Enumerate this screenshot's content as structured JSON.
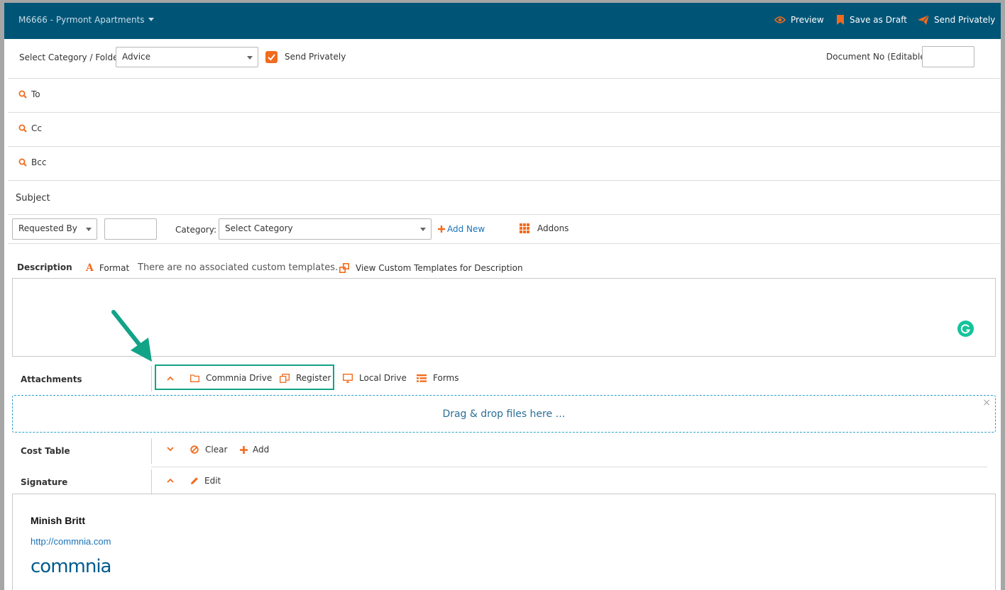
{
  "header": {
    "project_title": "M6666 - Pyrmont Apartments",
    "preview_label": "Preview",
    "save_draft_label": "Save as Draft",
    "send_privately_label": "Send Privately"
  },
  "row1": {
    "category_folder_label": "Select Category / Folder",
    "category_folder_value": "Advice",
    "send_privately_checkbox_label": "Send Privately",
    "send_privately_checked": true,
    "document_no_label": "Document No (Editable):",
    "document_no_value": ""
  },
  "recipients": {
    "to_label": "To",
    "cc_label": "Cc",
    "bcc_label": "Bcc"
  },
  "subject": {
    "label": "Subject"
  },
  "meta_row": {
    "requested_by_value": "Requested By",
    "requested_by_input": "",
    "category_label": "Category:",
    "category_value": "Select Category",
    "add_new_label": "Add New",
    "addons_label": "Addons"
  },
  "description": {
    "label": "Description",
    "format_label": "Format",
    "no_templates_text": "There are no associated custom templates.",
    "view_templates_label": "View Custom Templates for Description"
  },
  "attachments": {
    "label": "Attachments",
    "commnia_drive_label": "Commnia Drive",
    "register_label": "Register",
    "local_drive_label": "Local Drive",
    "forms_label": "Forms",
    "dropzone_text": "Drag & drop files here …",
    "dropzone_close": "×"
  },
  "cost_table": {
    "label": "Cost Table",
    "clear_label": "Clear",
    "add_label": "Add"
  },
  "signature": {
    "label": "Signature",
    "edit_label": "Edit",
    "name": "Minish Britt",
    "url": "http://commnia.com",
    "logo_text": "commnia"
  },
  "colors": {
    "header_bg": "#005577",
    "accent_orange": "#f26b1d",
    "highlight_green": "#13a387",
    "link_blue": "#1a73b8"
  },
  "icons": {
    "preview": "eye-icon",
    "save_draft": "bookmark-icon",
    "send": "paper-plane-icon",
    "search": "search-icon",
    "format": "letter-a-icon",
    "templates": "window-restore-icon",
    "grammarly": "grammarly-icon",
    "folder": "folder-icon",
    "register": "copy-icon",
    "local_drive": "desktop-icon",
    "forms": "list-icon",
    "clear": "ban-icon",
    "add": "plus-icon",
    "edit": "pencil-icon",
    "addons": "grid-icon",
    "annotation_arrow": "arrow-icon"
  }
}
